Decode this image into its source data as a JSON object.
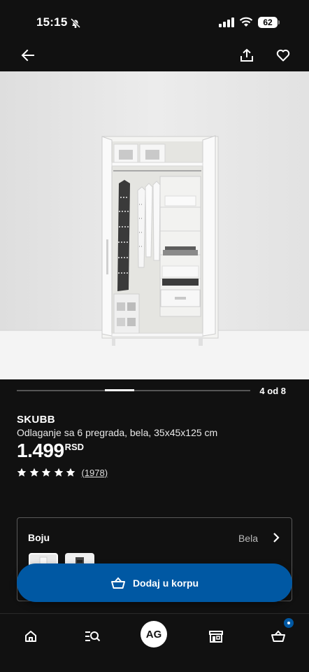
{
  "status": {
    "time": "15:15",
    "battery": "62"
  },
  "toolbar": {
    "back_icon": "arrow-left-icon",
    "share_icon": "share-icon",
    "favorite_icon": "heart-icon"
  },
  "gallery": {
    "position_label": "4 od 8",
    "current_index": 4,
    "total": 8
  },
  "product": {
    "brand": "SKUBB",
    "description": "Odlaganje sa 6 pregrada, bela, 35x45x125 cm",
    "price": "1.499",
    "currency": "RSD",
    "rating_stars": 5,
    "rating_count": "(1978)"
  },
  "color": {
    "label": "Boju",
    "selected": "Bela"
  },
  "cart_button": {
    "label": "Dodaj u korpu"
  },
  "nav": {
    "profile_initials": "AG"
  },
  "colors": {
    "accent": "#0058a3",
    "background": "#111111",
    "image_bg": "#e6e6e6"
  }
}
